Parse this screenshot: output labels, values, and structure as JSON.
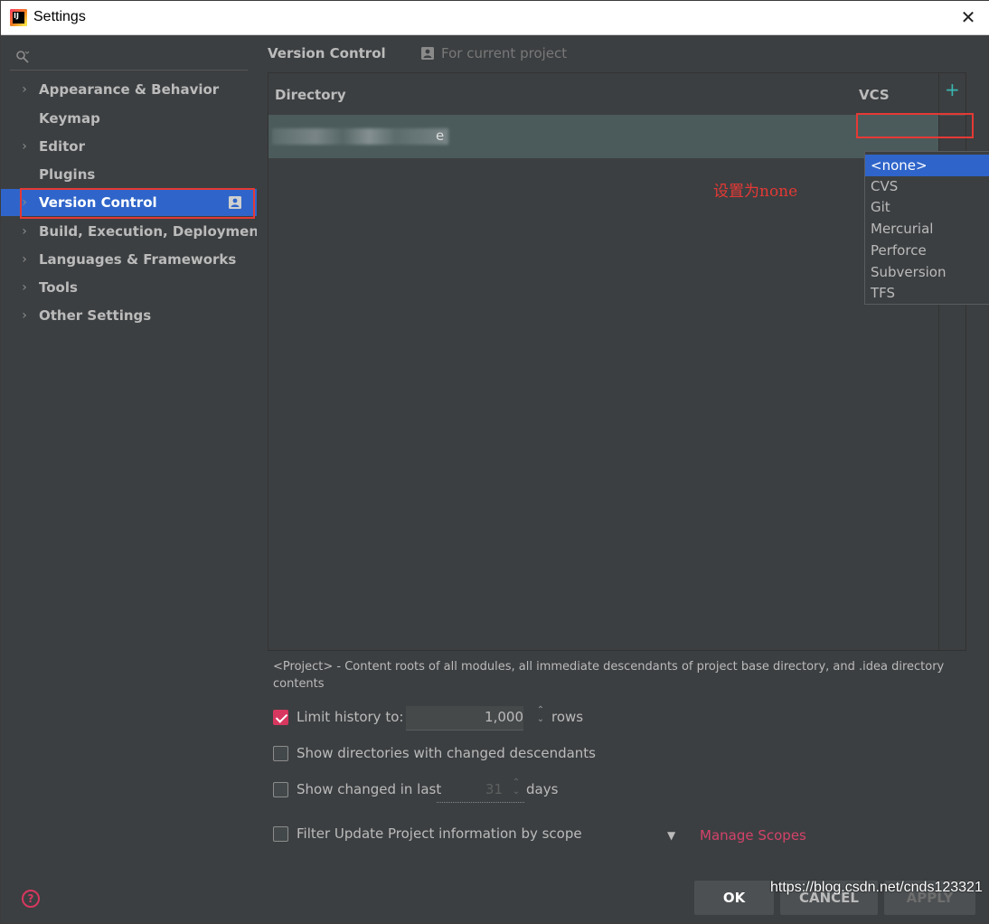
{
  "window": {
    "title": "Settings",
    "app_icon_text": "IJ",
    "close_glyph": "✕"
  },
  "sidebar": {
    "search_placeholder": "",
    "items": [
      {
        "label": "Appearance & Behavior",
        "expandable": true
      },
      {
        "label": "Keymap",
        "expandable": false
      },
      {
        "label": "Editor",
        "expandable": true
      },
      {
        "label": "Plugins",
        "expandable": false
      },
      {
        "label": "Version Control",
        "expandable": true,
        "selected": true,
        "project_icon": "project-scope-icon"
      },
      {
        "label": "Build, Execution, Deployment",
        "expandable": true
      },
      {
        "label": "Languages & Frameworks",
        "expandable": true
      },
      {
        "label": "Tools",
        "expandable": true
      },
      {
        "label": "Other Settings",
        "expandable": true
      }
    ]
  },
  "main": {
    "breadcrumb": "Version Control",
    "scope_label": "For current project",
    "table": {
      "columns": {
        "directory": "Directory",
        "vcs": "VCS"
      },
      "add_glyph": "+",
      "rows": [
        {
          "directory": "e"
        }
      ]
    },
    "vcs_dropdown": {
      "options": [
        "<none>",
        "CVS",
        "Git",
        "Mercurial",
        "Perforce",
        "Subversion",
        "TFS"
      ],
      "selected": "<none>"
    },
    "annotation": "设置为none",
    "description": "<Project> - Content roots of all modules, all immediate descendants of project base directory, and .idea directory contents",
    "options": {
      "limit_history": {
        "label": "Limit history to:",
        "checked": true,
        "value": "1,000",
        "suffix": "rows"
      },
      "show_dirs": {
        "label": "Show directories with changed descendants",
        "checked": false
      },
      "show_changed": {
        "label": "Show changed in last",
        "checked": false,
        "value": "31",
        "suffix": "days"
      },
      "filter_update": {
        "label": "Filter Update Project information by scope",
        "checked": false
      },
      "manage_scopes": "Manage Scopes"
    }
  },
  "footer": {
    "help_glyph": "?",
    "ok": "OK",
    "cancel": "CANCEL",
    "apply": "APPLY"
  },
  "watermark": "https://blog.csdn.net/cnds123321",
  "colors": {
    "accent": "#d8375f",
    "selection": "#2f65ca",
    "annotation": "#e53935",
    "background": "#3c3f41"
  }
}
